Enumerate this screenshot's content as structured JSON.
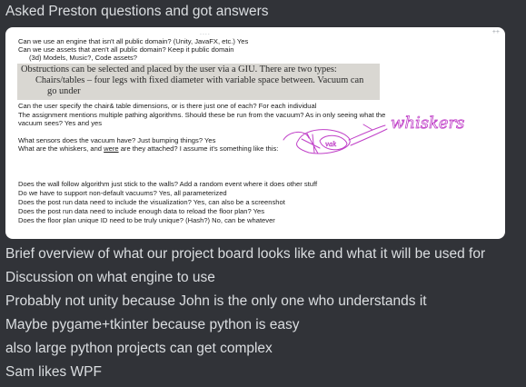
{
  "message": {
    "lines": [
      "Asked Preston questions and got answers",
      "Brief overview of what our project board looks like and what it will be used for",
      "Discussion on what engine to use",
      "Probably not unity because John is the only one who understands it",
      "Maybe pygame+tkinter because python is easy",
      "also large python projects can get complex",
      "Sam likes WPF"
    ]
  },
  "attachment": {
    "scroll_top_glyph": "....",
    "scroll_right_glyph": "++",
    "notes": [
      "Can we use an engine that isn't all public domain? (Unity, JavaFX, etc.) Yes",
      "Can we use assets that aren't all public domain? Keep it public domain",
      "(3d) Models, Music?, Code assets?",
      "Can the user specify the chair& table dimensions, or is there just one of each? For each individual",
      "The assignment mentions multiple pathing algorithms. Should these be run from the vacuum? As in only seeing what the",
      "vacuum sees? Yes and yes",
      "What sensors does the vacuum have? Just bumping things? Yes",
      "What are the whiskers, and ",
      "were",
      " are they attached? I assume it's something like this:",
      "Does the wall follow algorithm just stick to the walls? Add a random event where it does other stuff",
      "Do we have to support non-default vacuums? Yes, all parameterized",
      "Does the post run data need to include the visualization? Yes, can also be a screenshot",
      "Does the post run data need to include enough data to reload the floor plan? Yes",
      "Does the floor plan unique ID need to be truly unique? (Hash?)  No, can be whatever"
    ],
    "scan_excerpt": [
      "Obstructions can be selected and placed by the user via a GIU. There are two types:",
      "Chairs/tables – four legs with fixed diameter with variable space between. Vacuum can",
      "go under"
    ],
    "sketch": {
      "annotation": "whiskers",
      "body_label": "vak",
      "ink_color": "#c040c8"
    }
  }
}
